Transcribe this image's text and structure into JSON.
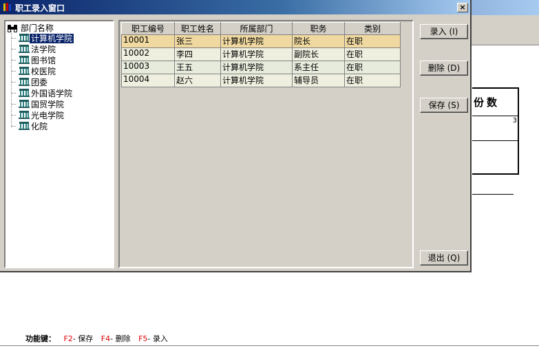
{
  "window": {
    "title": "职工录入窗口",
    "close_label": "×"
  },
  "background": {
    "box_heading": "份数",
    "box_number": "3",
    "function_bar": {
      "label": "功能键：",
      "keys": [
        {
          "key": "F2",
          "action": "- 保存"
        },
        {
          "key": "F4",
          "action": "- 删除"
        },
        {
          "key": "F5",
          "action": "- 录入"
        }
      ]
    }
  },
  "tree": {
    "root_label": "部门名称",
    "items": [
      {
        "label": "计算机学院",
        "selected": true
      },
      {
        "label": "法学院"
      },
      {
        "label": "图书馆"
      },
      {
        "label": "校医院"
      },
      {
        "label": "团委"
      },
      {
        "label": "外国语学院"
      },
      {
        "label": "国贸学院"
      },
      {
        "label": "光电学院"
      },
      {
        "label": "化院"
      }
    ]
  },
  "grid": {
    "columns": [
      "职工编号",
      "职工姓名",
      "所属部门",
      "职务",
      "类别"
    ],
    "rows": [
      [
        "10001",
        "张三",
        "计算机学院",
        "院长",
        "在职"
      ],
      [
        "10002",
        "李四",
        "计算机学院",
        "副院长",
        "在职"
      ],
      [
        "10003",
        "王五",
        "计算机学院",
        "系主任",
        "在职"
      ],
      [
        "10004",
        "赵六",
        "计算机学院",
        "辅导员",
        "在职"
      ]
    ]
  },
  "buttons": {
    "enter": "录入 (I)",
    "delete": "删除 (D)",
    "save": "保存 (S)",
    "exit": "退出 (Q)"
  },
  "colors": {
    "selected_row": "#f0d9a0",
    "title_bar": "#0a246a",
    "function_key": "#e00000"
  }
}
